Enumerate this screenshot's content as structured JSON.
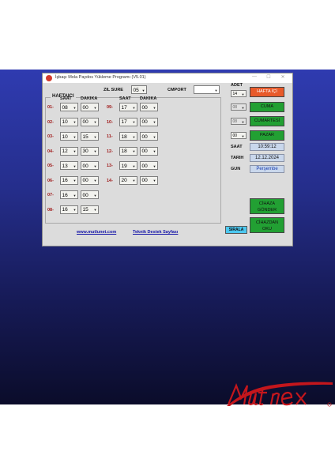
{
  "window": {
    "title": "İşbaşı Mola Paydos  Yükleme Programı  (V5.01)",
    "controls": {
      "minimize": "—",
      "maximize": "☐",
      "close": "✕"
    }
  },
  "top": {
    "zil_sure_label": "ZIL SURE",
    "zil_sure_value": "05",
    "cmport_label": "CMPORT",
    "cmport_value": ""
  },
  "haftaici": {
    "label": "HAFTAICI",
    "col_saat": "SAAT",
    "col_dakika": "DAKIKA",
    "rows": [
      {
        "label": "01-",
        "saat": "08",
        "dakika": "00"
      },
      {
        "label": "02-",
        "saat": "10",
        "dakika": "00"
      },
      {
        "label": "03-",
        "saat": "10",
        "dakika": "15"
      },
      {
        "label": "04-",
        "saat": "12",
        "dakika": "30"
      },
      {
        "label": "05-",
        "saat": "13",
        "dakika": "00"
      },
      {
        "label": "06-",
        "saat": "16",
        "dakika": "00"
      },
      {
        "label": "07-",
        "saat": "16",
        "dakika": "00"
      },
      {
        "label": "08-",
        "saat": "16",
        "dakika": "15"
      },
      {
        "label": "09-",
        "saat": "17",
        "dakika": "00"
      },
      {
        "label": "10-",
        "saat": "17",
        "dakika": "00"
      },
      {
        "label": "11-",
        "saat": "18",
        "dakika": "00"
      },
      {
        "label": "12-",
        "saat": "18",
        "dakika": "00"
      },
      {
        "label": "13-",
        "saat": "19",
        "dakika": "00"
      },
      {
        "label": "14-",
        "saat": "20",
        "dakika": "00"
      }
    ]
  },
  "adet": {
    "label": "ADET",
    "value": "14",
    "cuma": "08",
    "cumartesi": "08",
    "pazar": "00"
  },
  "buttons": {
    "hafta_ici": "HAFTA İÇİ",
    "cuma": "CUMA",
    "cumartesi": "CUMARTESİ",
    "pazar": "PAZAR",
    "cihaza_gonder_1": "CİHAZA",
    "cihaza_gonder_2": "GÖNDER",
    "cihazdan_oku_1": "CİHAZDAN",
    "cihazdan_oku_2": "OKU",
    "sirala": "SIRALA"
  },
  "info": {
    "saat_label": "SAAT",
    "saat_value": "10:59:12",
    "tarih_label": "TARIH",
    "tarih_value": "12.12.2024",
    "gun_label": "GUN",
    "gun_value": "Perşembe"
  },
  "links": {
    "website": "www.mutlunet.com",
    "support": "Teknik Destek Sayfası"
  },
  "brand": {
    "logo_text": "Mutnex",
    "logo_color": "#c4161c"
  }
}
